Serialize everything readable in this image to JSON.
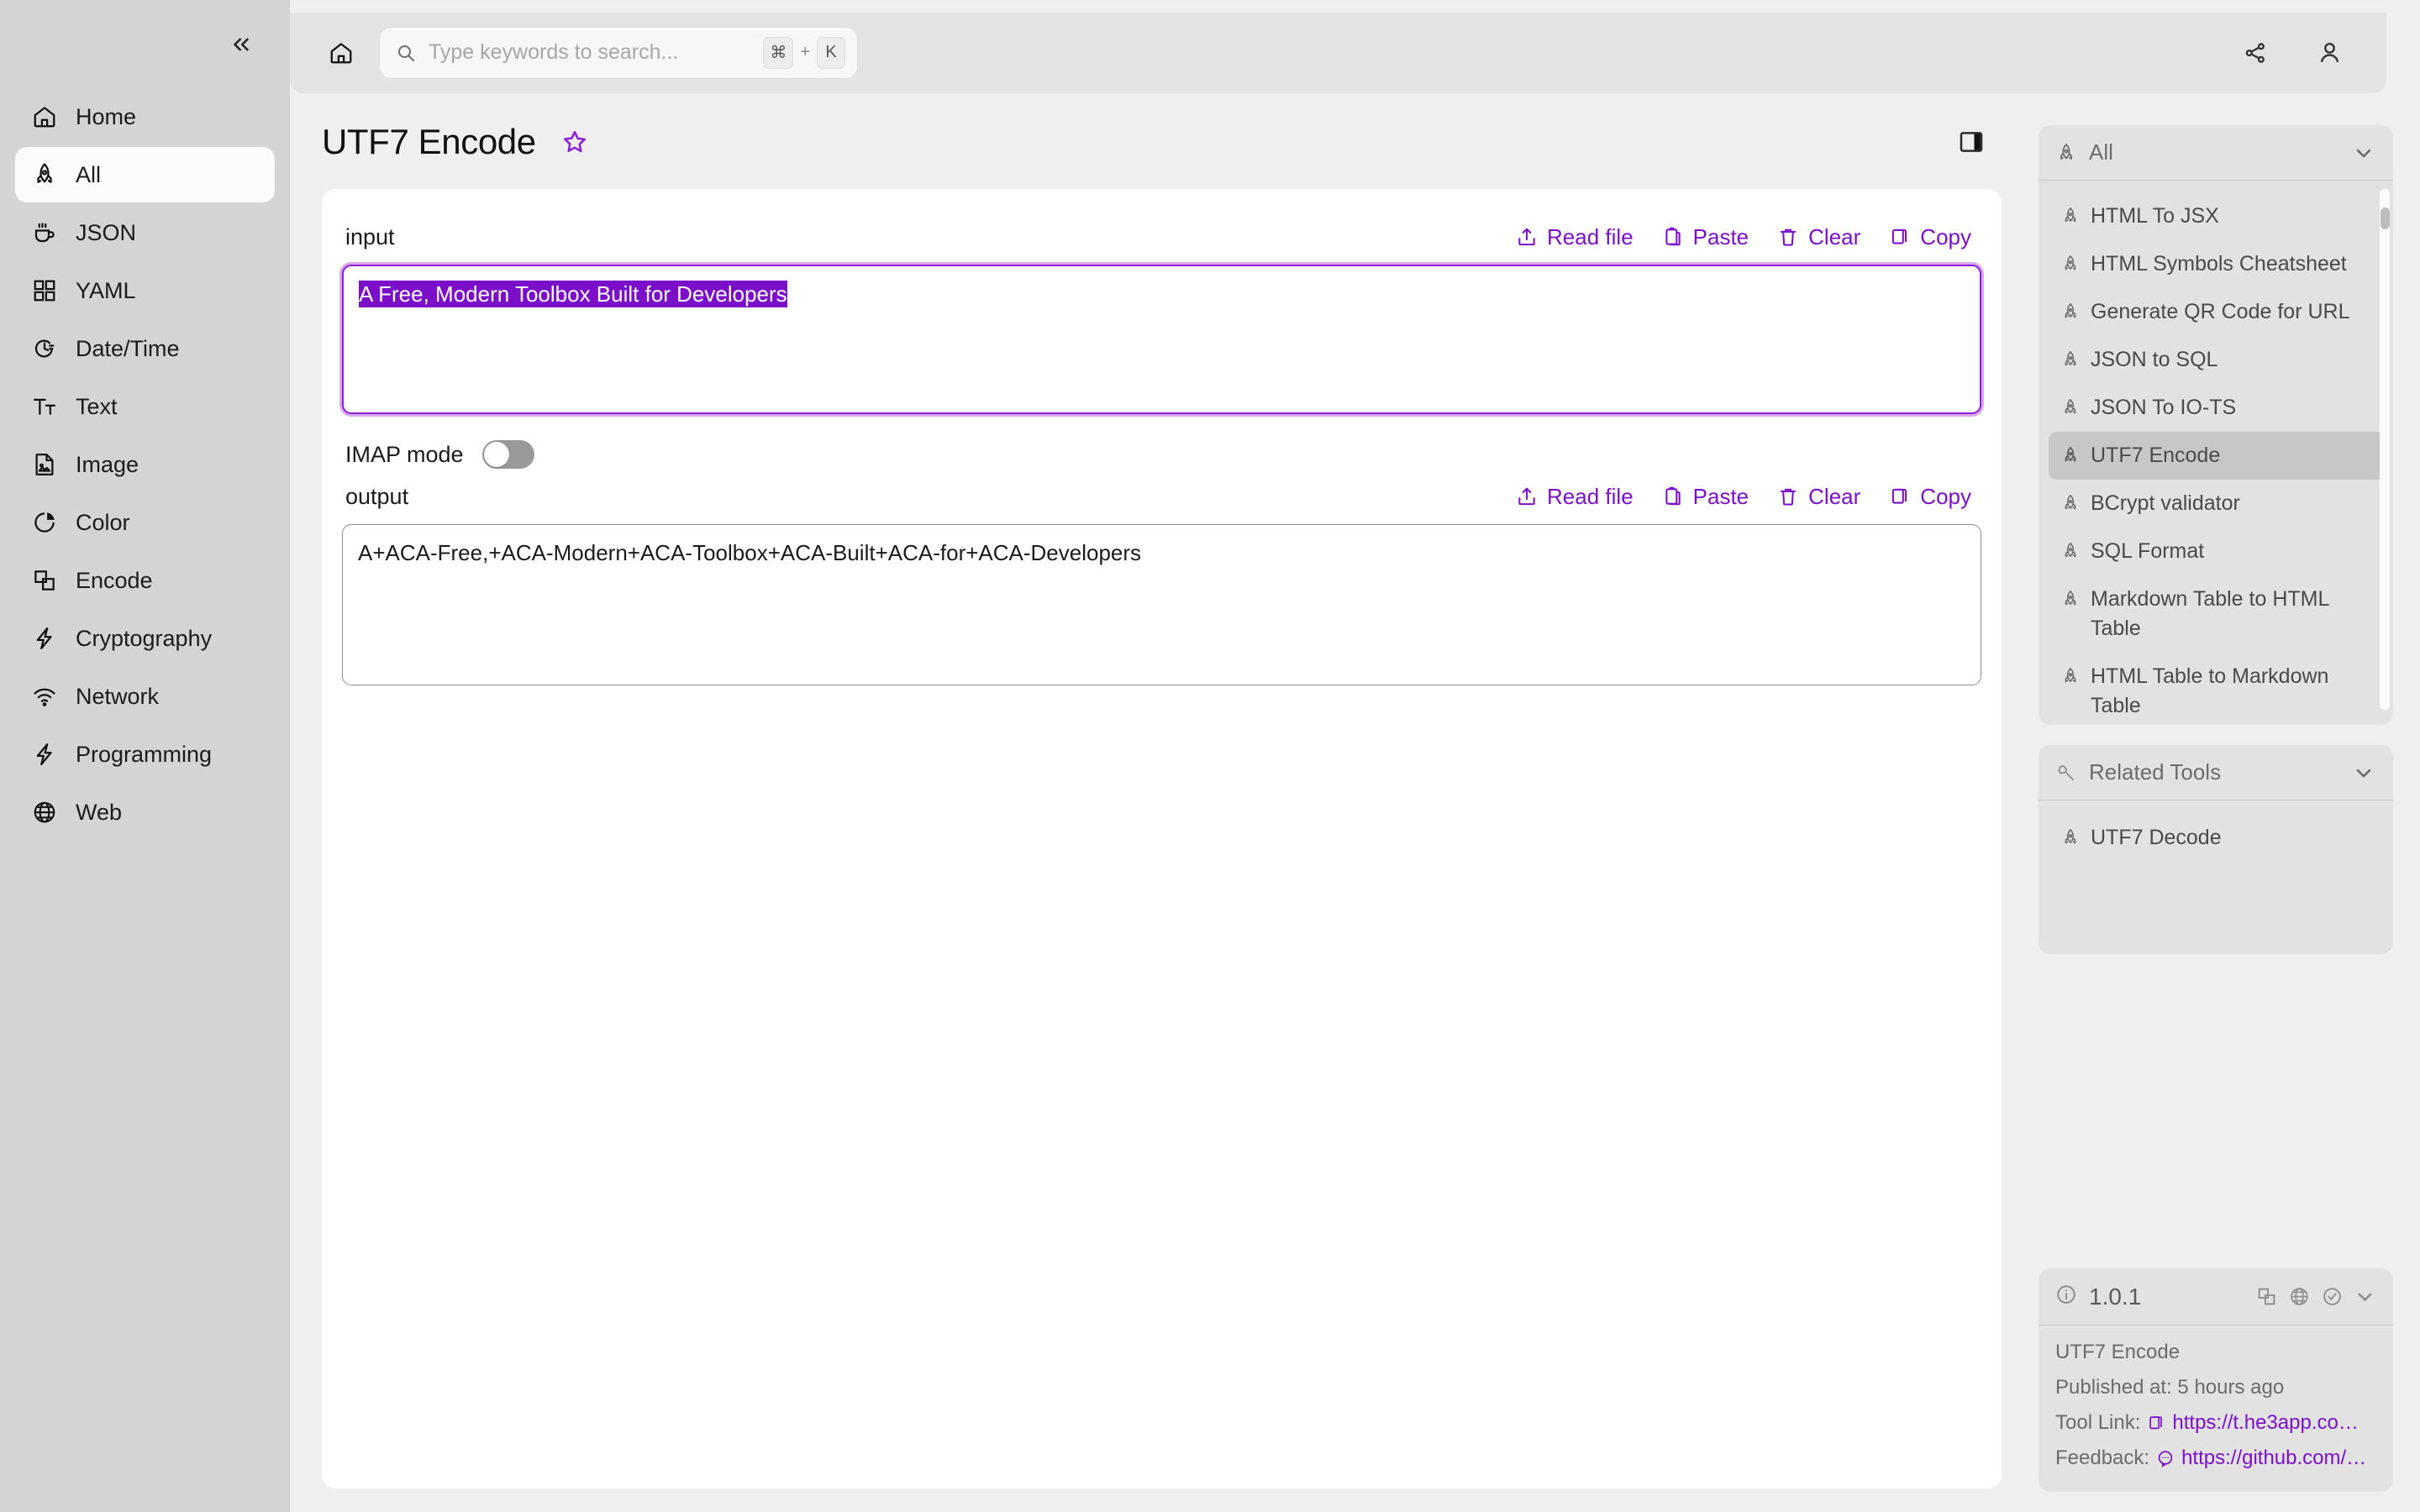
{
  "sidebar": {
    "collapse_label": "«",
    "items": [
      {
        "label": "Home",
        "icon": "home-icon",
        "active": false
      },
      {
        "label": "All",
        "icon": "rocket-icon",
        "active": true
      },
      {
        "label": "JSON",
        "icon": "coffee-icon",
        "active": false
      },
      {
        "label": "YAML",
        "icon": "grid-icon",
        "active": false
      },
      {
        "label": "Date/Time",
        "icon": "clock-icon",
        "active": false
      },
      {
        "label": "Text",
        "icon": "text-icon",
        "active": false
      },
      {
        "label": "Image",
        "icon": "image-icon",
        "active": false
      },
      {
        "label": "Color",
        "icon": "pie-chart-icon",
        "active": false
      },
      {
        "label": "Encode",
        "icon": "layers-icon",
        "active": false
      },
      {
        "label": "Cryptography",
        "icon": "bolt-icon",
        "active": false
      },
      {
        "label": "Network",
        "icon": "wifi-icon",
        "active": false
      },
      {
        "label": "Programming",
        "icon": "bolt-icon",
        "active": false
      },
      {
        "label": "Web",
        "icon": "globe-icon",
        "active": false
      }
    ]
  },
  "topbar": {
    "home_icon": "home-icon",
    "search": {
      "placeholder": "Type keywords to search...",
      "value": "",
      "kbd_meta": "⌘",
      "kbd_plus": "+",
      "kbd_key": "K"
    },
    "share_icon": "share-icon",
    "account_icon": "user-icon"
  },
  "page": {
    "title": "UTF7 Encode",
    "star_icon": "star-outline-icon",
    "panel_toggle_icon": "right-panel-toggle-icon"
  },
  "input_section": {
    "label": "input",
    "value": "A Free, Modern Toolbox Built for Developers",
    "selected": true,
    "actions": [
      {
        "label": "Read file",
        "icon": "upload-icon"
      },
      {
        "label": "Paste",
        "icon": "clipboard-icon"
      },
      {
        "label": "Clear",
        "icon": "trash-icon"
      },
      {
        "label": "Copy",
        "icon": "copy-icon"
      }
    ]
  },
  "imap": {
    "label": "IMAP mode",
    "enabled": false
  },
  "output_section": {
    "label": "output",
    "value": "A+ACA-Free,+ACA-Modern+ACA-Toolbox+ACA-Built+ACA-for+ACA-Developers",
    "actions": [
      {
        "label": "Read file",
        "icon": "upload-icon"
      },
      {
        "label": "Paste",
        "icon": "clipboard-icon"
      },
      {
        "label": "Clear",
        "icon": "trash-icon"
      },
      {
        "label": "Copy",
        "icon": "copy-icon"
      }
    ]
  },
  "all_panel": {
    "title": "All",
    "head_icon": "rocket-icon",
    "chevron_icon": "chevron-down-icon",
    "items": [
      {
        "label": "HTML To JSX",
        "selected": false
      },
      {
        "label": "HTML Symbols Cheatsheet",
        "selected": false
      },
      {
        "label": "Generate QR Code for URL",
        "selected": false
      },
      {
        "label": "JSON to SQL",
        "selected": false
      },
      {
        "label": "JSON To IO-TS",
        "selected": false
      },
      {
        "label": "UTF7 Encode",
        "selected": true
      },
      {
        "label": "BCrypt validator",
        "selected": false
      },
      {
        "label": "SQL Format",
        "selected": false
      },
      {
        "label": "Markdown Table to HTML Table",
        "selected": false
      },
      {
        "label": "HTML Table to Markdown Table",
        "selected": false
      }
    ]
  },
  "related_panel": {
    "title": "Related Tools",
    "head_icon": "wrench-icon",
    "chevron_icon": "chevron-down-icon",
    "items": [
      {
        "label": "UTF7 Decode"
      }
    ]
  },
  "version_panel": {
    "version": "1.0.1",
    "info_icon": "info-circle-icon",
    "icons": [
      "copy-icon",
      "globe-icon",
      "check-circle-icon",
      "chevron-down-icon"
    ],
    "tool_name": "UTF7 Encode",
    "published": "Published at: 5 hours ago",
    "tool_link_label": "Tool Link:",
    "tool_link_value": "https://t.he3app.co…",
    "feedback_label": "Feedback:",
    "feedback_value": "https://github.com/…"
  },
  "colors": {
    "accent": "#7b10c9",
    "focus_border": "#8c1ed6",
    "selection": "#7b0fc9",
    "sidebar_bg": "#d4d4d4",
    "page_bg": "#efefef",
    "rail_card_bg": "#e2e2e2"
  }
}
